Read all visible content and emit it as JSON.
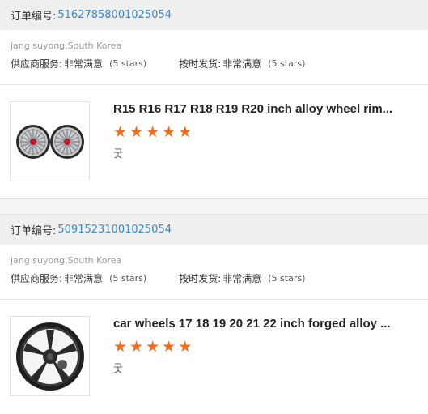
{
  "orders": [
    {
      "order_label": "订单编号:",
      "order_number": "51627858001025054",
      "buyer": "jang suyong,South Korea",
      "supplier_service_label": "供应商服务:",
      "supplier_service_value": "非常满意",
      "supplier_service_stars": "(5 stars)",
      "delivery_label": "按时发货:",
      "delivery_value": "非常满意",
      "delivery_stars": "(5 stars)",
      "product_title": "R15 R16 R17 R18 R19 R20 inch alloy wheel rim...",
      "rating": 5,
      "comment": "굿",
      "image_icon": "twin-spoke-wheels-image"
    },
    {
      "order_label": "订单编号:",
      "order_number": "50915231001025054",
      "buyer": "jang suyong,South Korea",
      "supplier_service_label": "供应商服务:",
      "supplier_service_value": "非常满意",
      "supplier_service_stars": "(5 stars)",
      "delivery_label": "按时发货:",
      "delivery_value": "非常满意",
      "delivery_stars": "(5 stars)",
      "product_title": "car wheels 17 18 19 20 21 22 inch forged alloy ...",
      "rating": 5,
      "comment": "굿",
      "image_icon": "black-forged-wheel-image"
    }
  ],
  "colors": {
    "link": "#3a87c9",
    "star": "#f26b1d",
    "header_bg": "#efefef"
  }
}
